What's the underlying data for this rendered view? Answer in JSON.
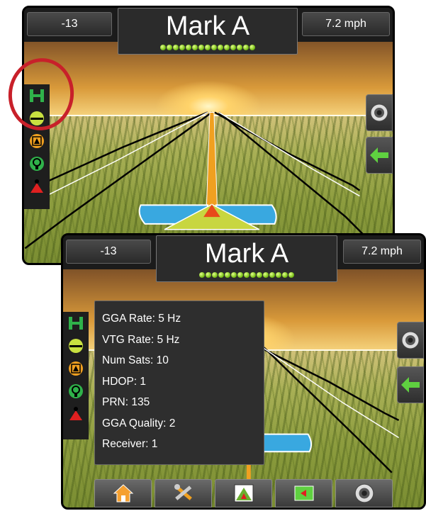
{
  "screens": [
    {
      "left_value": "-13",
      "title": "Mark A",
      "speed": "7.2 mph",
      "satellite_count": 15
    },
    {
      "left_value": "-13",
      "title": "Mark A",
      "speed": "7.2 mph",
      "satellite_count": 15,
      "gps_status": {
        "gga_rate": "GGA Rate: 5 Hz",
        "vtg_rate": "VTG Rate: 5 Hz",
        "num_sats": "Num Sats: 10",
        "hdop": "HDOP: 1",
        "prn": "PRN: 135",
        "gga_quality": "GGA Quality: 2",
        "receiver": "Receiver: 1"
      }
    }
  ],
  "left_icons": [
    "gps-status-icon",
    "lightbar-icon",
    "warning-icon",
    "section-control-icon",
    "marker-icon"
  ],
  "right_icons": [
    "camera-icon",
    "back-arrow-icon"
  ],
  "bottom_tabs": [
    "home-icon",
    "tools-icon",
    "guidance-view-icon",
    "field-marker-icon",
    "camera-icon"
  ],
  "colors": {
    "highlight": "#c8202a",
    "accent_green": "#2fb24a",
    "guidance_orange": "#f0a020",
    "lightbar_blue": "#39a8e0"
  }
}
